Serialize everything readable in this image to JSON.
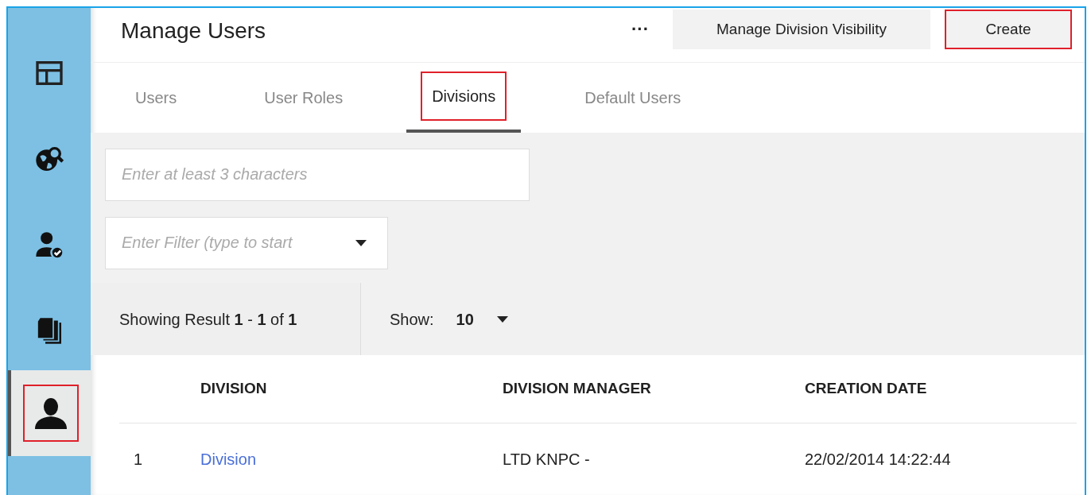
{
  "sidebar": {
    "items": [
      {
        "kind": "layout",
        "selected": false,
        "highlighted": false
      },
      {
        "kind": "globe",
        "selected": false,
        "highlighted": false
      },
      {
        "kind": "usercheck",
        "selected": false,
        "highlighted": false
      },
      {
        "kind": "documents",
        "selected": false,
        "highlighted": false
      },
      {
        "kind": "user",
        "selected": true,
        "highlighted": true
      }
    ]
  },
  "header": {
    "title": "Manage Users",
    "more": "···",
    "buttons": [
      {
        "label": "Manage Division Visibility",
        "highlighted": false
      },
      {
        "label": "Create",
        "highlighted": true
      }
    ]
  },
  "tabs": [
    {
      "label": "Users",
      "selected": false,
      "highlighted": false
    },
    {
      "label": "User Roles",
      "selected": false,
      "highlighted": false
    },
    {
      "label": "Divisions",
      "selected": true,
      "highlighted": true
    },
    {
      "label": "Default Users",
      "selected": false,
      "highlighted": false
    }
  ],
  "search": {
    "placeholder": "Enter at least 3 characters"
  },
  "filter": {
    "placeholder": "Enter Filter (type to start"
  },
  "results": {
    "summary": "Showing Result **1** - **1** of **1**",
    "show_label": "Show:",
    "show_value": "10"
  },
  "table": {
    "columns": [
      "",
      "DIVISION",
      "DIVISION MANAGER",
      "CREATION DATE"
    ],
    "rows": [
      {
        "index": "1",
        "division": "Division",
        "manager": "LTD KNPC -",
        "date": "22/02/2014 14:22:44"
      }
    ]
  }
}
